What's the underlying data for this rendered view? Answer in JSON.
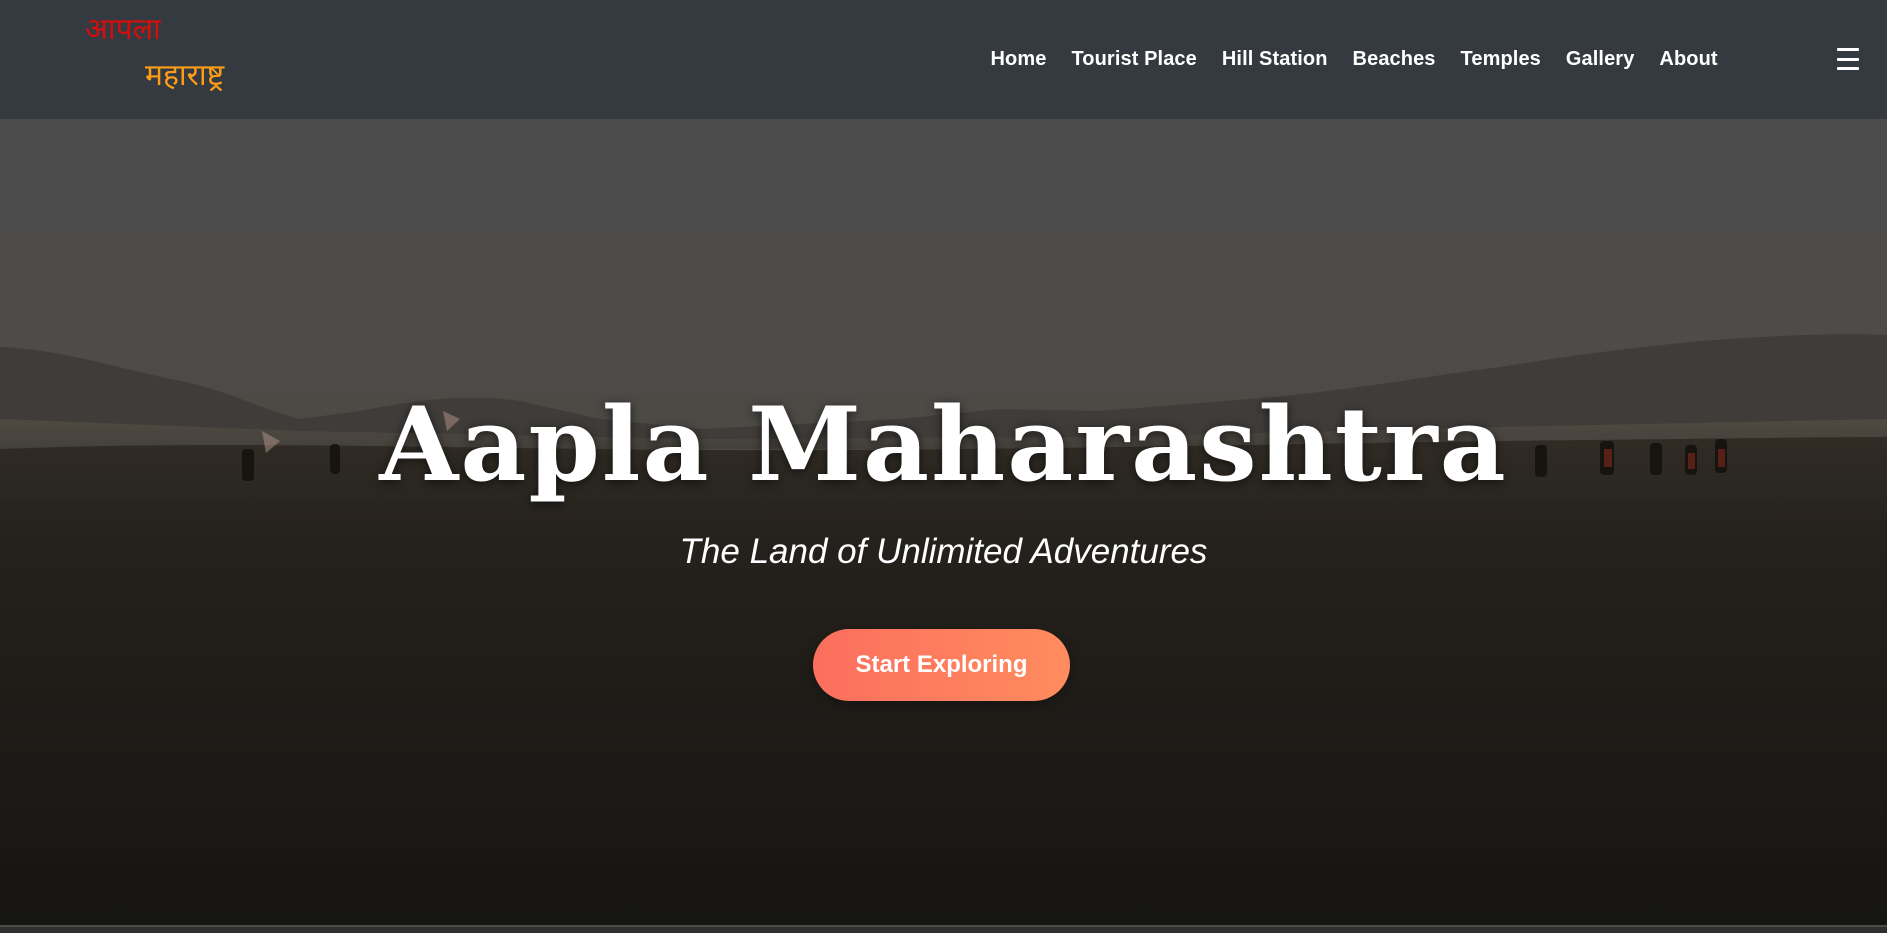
{
  "brand": {
    "line1": "आपला",
    "line2": "महाराष्ट्र",
    "line1_color": "#d40d0d",
    "line2_color": "#ff9e16"
  },
  "nav": {
    "items": [
      {
        "label": "Home"
      },
      {
        "label": "Tourist Place"
      },
      {
        "label": "Hill Station"
      },
      {
        "label": "Beaches"
      },
      {
        "label": "Temples"
      },
      {
        "label": "Gallery"
      },
      {
        "label": "About"
      }
    ],
    "menu_icon": "hamburger-menu-icon",
    "background": "#343a40"
  },
  "hero": {
    "title": "Aapla Maharashtra",
    "subtitle": "The Land of Unlimited Adventures",
    "cta_label": "Start Exploring",
    "cta_gradient": [
      "#fc6e5e",
      "#ff8c5e"
    ]
  }
}
